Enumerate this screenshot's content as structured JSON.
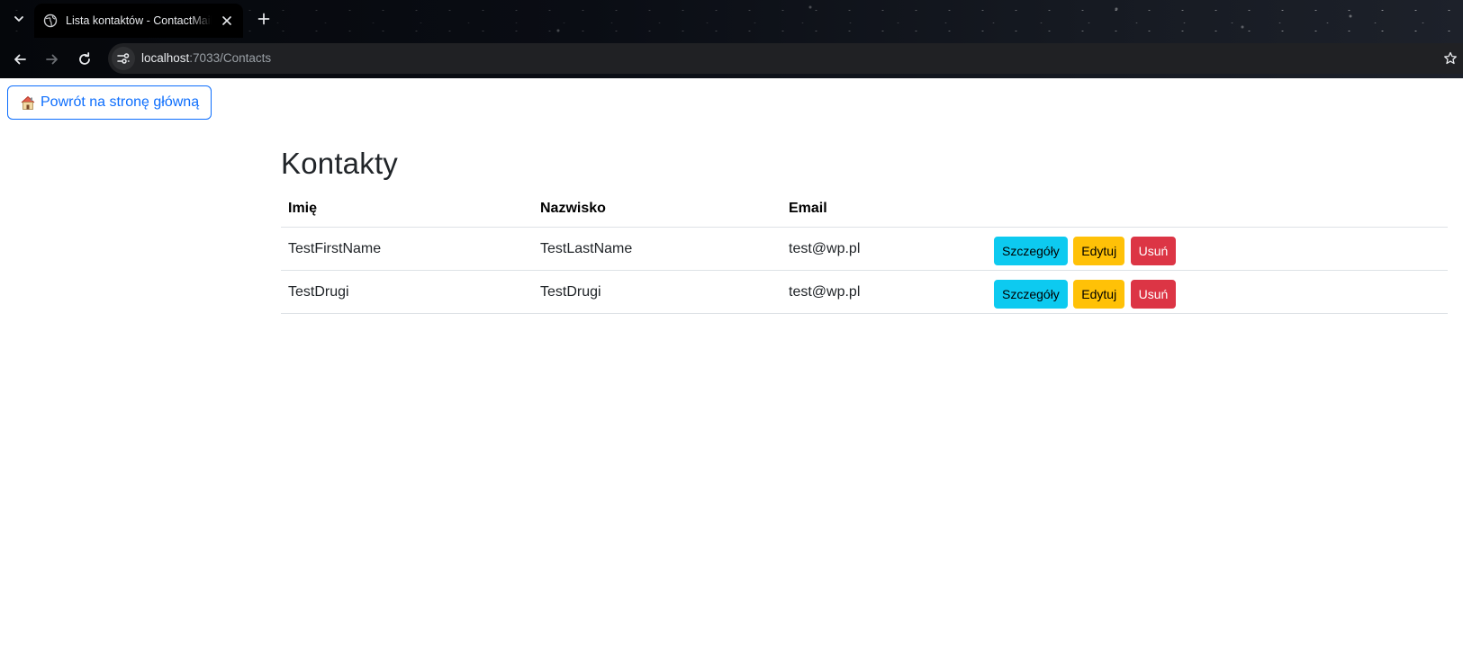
{
  "browser": {
    "tab": {
      "title": "Lista kontaktów - ContactMailer"
    },
    "address_bar": {
      "host": "localhost",
      "path": ":7033/Contacts"
    }
  },
  "page": {
    "home_button_label": "Powrót na stronę główną",
    "title": "Kontakty",
    "table": {
      "headers": {
        "first_name": "Imię",
        "last_name": "Nazwisko",
        "email": "Email"
      },
      "rows": [
        {
          "first_name": "TestFirstName",
          "last_name": "TestLastName",
          "email": "test@wp.pl"
        },
        {
          "first_name": "TestDrugi",
          "last_name": "TestDrugi",
          "email": "test@wp.pl"
        }
      ],
      "actions": {
        "details": "Szczegóły",
        "edit": "Edytuj",
        "delete": "Usuń"
      }
    }
  },
  "colors": {
    "primary": "#0d6efd",
    "info": "#0dcaf0",
    "warning": "#ffc107",
    "danger": "#dc3545"
  },
  "icons": [
    "chevron-down-icon",
    "globe-icon",
    "close-icon",
    "plus-icon",
    "back-arrow-icon",
    "forward-arrow-icon",
    "reload-icon",
    "site-settings-icon",
    "bookmark-star-icon",
    "house-icon"
  ]
}
